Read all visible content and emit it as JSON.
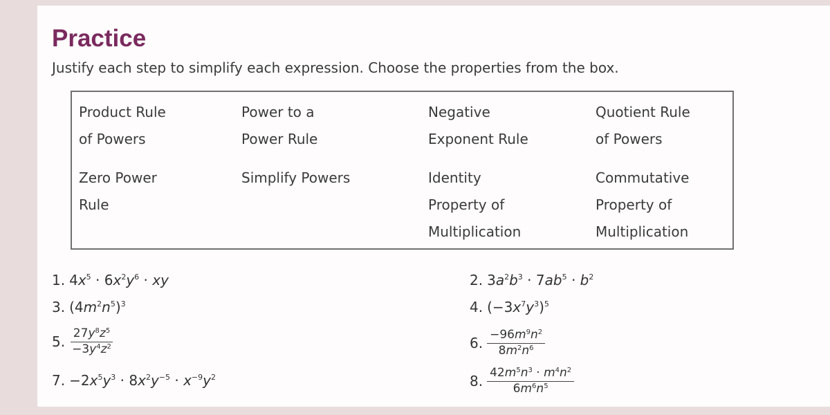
{
  "title": "Practice",
  "instructions": "Justify each step to simplify each expression. Choose the properties from the box.",
  "properties": [
    "Product Rule\nof Powers",
    "Power to a\nPower Rule",
    "Negative\nExponent Rule",
    "Quotient Rule\nof Powers",
    "Zero Power\nRule",
    "Simplify Powers",
    "Identity\nProperty of\nMultiplication",
    "Commutative\nProperty of\nMultiplication"
  ],
  "problems": [
    {
      "number": "1.",
      "expression": "4x^5 · 6x^2y^6 · xy"
    },
    {
      "number": "2.",
      "expression": "3a^2b^3 · 7ab^5 · b^2"
    },
    {
      "number": "3.",
      "expression": "(4m^2n^5)^3"
    },
    {
      "number": "4.",
      "expression": "(−3x^7y^3)^5"
    },
    {
      "number": "5.",
      "numerator": "27y^8z^5",
      "denominator": "−3y^4z^2"
    },
    {
      "number": "6.",
      "numerator": "−96m^9n^2",
      "denominator": "8m^2n^6"
    },
    {
      "number": "7.",
      "expression": "−2x^5y^3 · 8x^2y^−5 · x^−9y^2"
    },
    {
      "number": "8.",
      "numerator": "42m^5n^3 · m^4n^2",
      "denominator": "6m^6n^5"
    }
  ]
}
